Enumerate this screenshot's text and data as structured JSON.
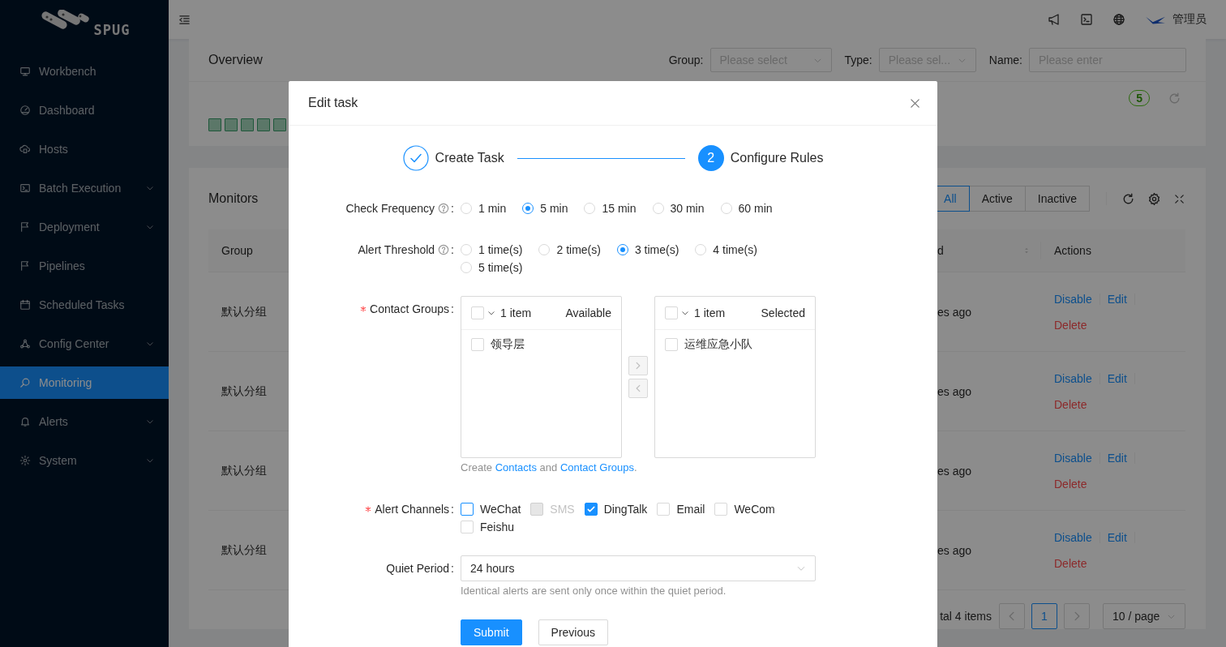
{
  "sidebar": {
    "brand": "SPUG",
    "items": [
      {
        "label": "Workbench",
        "expandable": false,
        "selected": false
      },
      {
        "label": "Dashboard",
        "expandable": false,
        "selected": false
      },
      {
        "label": "Hosts",
        "expandable": false,
        "selected": false
      },
      {
        "label": "Batch Execution",
        "expandable": true,
        "selected": false
      },
      {
        "label": "Deployment",
        "expandable": true,
        "selected": false
      },
      {
        "label": "Pipelines",
        "expandable": false,
        "selected": false
      },
      {
        "label": "Scheduled Tasks",
        "expandable": false,
        "selected": false
      },
      {
        "label": "Config Center",
        "expandable": true,
        "selected": false
      },
      {
        "label": "Monitoring",
        "expandable": false,
        "selected": true
      },
      {
        "label": "Alerts",
        "expandable": true,
        "selected": false
      },
      {
        "label": "System",
        "expandable": true,
        "selected": false
      }
    ]
  },
  "header": {
    "user": "管理员"
  },
  "overview": {
    "title": "Overview",
    "filters": [
      {
        "label": "Group:",
        "kind": "select",
        "placeholder": "Please select"
      },
      {
        "label": "Type:",
        "kind": "select",
        "placeholder": "Please sel..."
      },
      {
        "label": "Name:",
        "kind": "input",
        "placeholder": "Please enter"
      }
    ],
    "count": "5",
    "status_blocks": [
      {
        "up": true
      },
      {
        "up": true
      },
      {
        "up": true
      },
      {
        "up": true
      },
      {
        "up": true
      }
    ]
  },
  "monitors": {
    "title": "Monitors",
    "filter_tabs": [
      {
        "label": "All",
        "selected": true
      },
      {
        "label": "Active",
        "selected": false
      },
      {
        "label": "Inactive",
        "selected": false
      }
    ],
    "columns": [
      "Group",
      "d",
      "Actions"
    ],
    "rows": [
      {
        "group": "默认分组",
        "column_2": "es ago",
        "actions": [
          {
            "label": "Disable",
            "kind": "link"
          },
          {
            "label": "Edit",
            "kind": "link"
          },
          {
            "label": "Delete",
            "kind": "danger"
          }
        ]
      },
      {
        "group": "默认分组",
        "column_2": "es ago",
        "actions": [
          {
            "label": "Disable",
            "kind": "link"
          },
          {
            "label": "Edit",
            "kind": "link"
          },
          {
            "label": "Delete",
            "kind": "danger"
          }
        ]
      },
      {
        "group": "默认分组",
        "column_2": "es ago",
        "actions": [
          {
            "label": "Disable",
            "kind": "link"
          },
          {
            "label": "Edit",
            "kind": "link"
          },
          {
            "label": "Delete",
            "kind": "danger"
          }
        ]
      },
      {
        "group": "默认分组",
        "column_2": "es ago",
        "actions": [
          {
            "label": "Disable",
            "kind": "link"
          },
          {
            "label": "Edit",
            "kind": "link"
          },
          {
            "label": "Delete",
            "kind": "danger"
          }
        ]
      }
    ],
    "pagination": {
      "total": "tal 4 items",
      "pages": [
        {
          "label": "1",
          "selected": true
        }
      ],
      "page_size": "10 / page"
    }
  },
  "modal": {
    "title": "Edit task",
    "steps": [
      {
        "label": "Create Task",
        "finished": true
      },
      {
        "label": "Configure Rules",
        "number": "2",
        "finished": false
      }
    ],
    "fields": [
      {
        "kind": "radio",
        "label": "Check Frequency",
        "colon": ":",
        "required": false,
        "help": true,
        "options": [
          {
            "label": "1 min",
            "selected": false
          },
          {
            "label": "5 min",
            "selected": true
          },
          {
            "label": "15 min",
            "selected": false
          },
          {
            "label": "30 min",
            "selected": false
          },
          {
            "label": "60 min",
            "selected": false
          }
        ]
      },
      {
        "kind": "radio",
        "label": "Alert Threshold",
        "colon": ":",
        "required": false,
        "help": true,
        "options": [
          {
            "label": "1 time(s)",
            "selected": false
          },
          {
            "label": "2 time(s)",
            "selected": false
          },
          {
            "label": "3 time(s)",
            "selected": true
          },
          {
            "label": "4 time(s)",
            "selected": false
          },
          {
            "label": "5 time(s)",
            "selected": false
          }
        ]
      },
      {
        "kind": "transfer",
        "label": "Contact Groups",
        "colon": ":",
        "required": true,
        "help": false,
        "lists": [
          {
            "count": "1 item",
            "title": "Available",
            "all_checked": false,
            "items": [
              {
                "label": "领导层",
                "checked": false
              }
            ]
          },
          {
            "count": "1 item",
            "title": "Selected",
            "all_checked": false,
            "items": [
              {
                "label": "运维应急小队",
                "checked": false
              }
            ]
          }
        ],
        "extra": [
          {
            "kind": "text",
            "text": "Create "
          },
          {
            "kind": "link",
            "text": "Contacts"
          },
          {
            "kind": "text",
            "text": " and "
          },
          {
            "kind": "link",
            "text": "Contact Groups"
          },
          {
            "kind": "text",
            "text": "."
          }
        ]
      },
      {
        "kind": "checkbox",
        "label": "Alert Channels",
        "colon": ":",
        "required": true,
        "help": false,
        "options": [
          {
            "label": "WeChat",
            "checked": false,
            "disabled": false,
            "focused": true
          },
          {
            "label": "SMS",
            "checked": false,
            "disabled": true,
            "focused": false
          },
          {
            "label": "DingTalk",
            "checked": true,
            "disabled": false,
            "focused": false
          },
          {
            "label": "Email",
            "checked": false,
            "disabled": false,
            "focused": false
          },
          {
            "label": "WeCom",
            "checked": false,
            "disabled": false,
            "focused": false
          },
          {
            "label": "Feishu",
            "checked": false,
            "disabled": false,
            "focused": false
          }
        ]
      },
      {
        "kind": "select",
        "label": "Quiet Period",
        "colon": ":",
        "required": false,
        "help": false,
        "value": "24 hours",
        "extra": [
          {
            "kind": "text",
            "text": "Identical alerts are sent only once within the quiet period."
          }
        ]
      }
    ],
    "actions": [
      {
        "label": "Submit",
        "kind": "primary"
      },
      {
        "label": "Previous",
        "kind": "default"
      }
    ]
  }
}
